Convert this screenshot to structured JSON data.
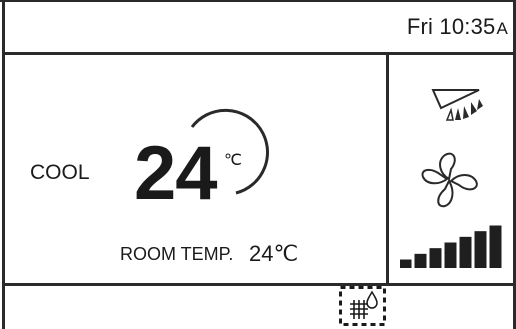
{
  "status_bar": {
    "day": "Fri",
    "time": "10:35",
    "ampm": "A"
  },
  "main": {
    "mode": "COOL",
    "set_temp": "24",
    "set_temp_unit": "℃",
    "room_temp_label": "ROOM TEMP.",
    "room_temp_value": "24℃"
  },
  "side": {
    "louver_icon": "swing-louver-icon",
    "fan_icon": "fan-icon",
    "fan_speed_level": 7,
    "fan_speed_max": 7
  },
  "bottom": {
    "filter_icon": "filter-drop-icon"
  },
  "colors": {
    "foreground": "#1a1a1a",
    "background": "#ffffff"
  }
}
